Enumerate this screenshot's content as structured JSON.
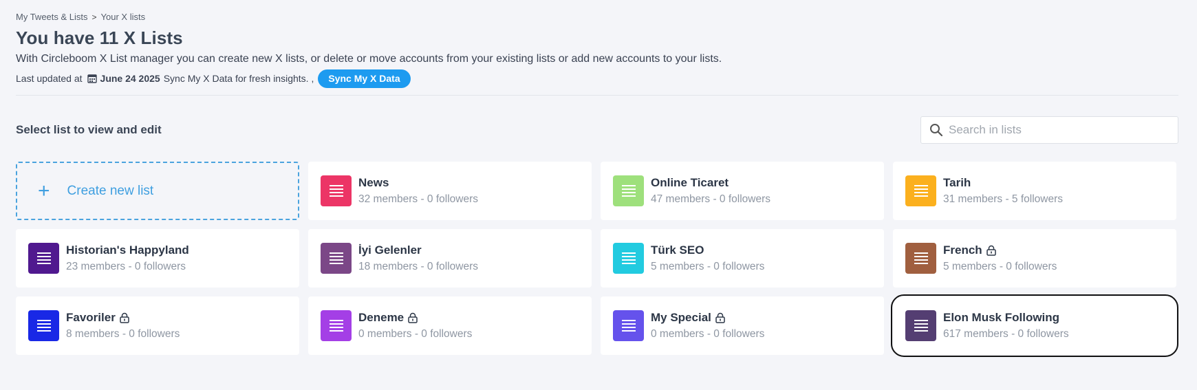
{
  "breadcrumb": {
    "item1": "My Tweets & Lists",
    "separator": ">",
    "item2": "Your X lists"
  },
  "header": {
    "title": "You have 11 X Lists",
    "description": "With Circleboom X List manager you can create new X lists, or delete or move accounts from your existing lists or add new accounts to your lists.",
    "last_updated_label": "Last updated at",
    "last_updated_date": "June 24 2025",
    "sync_text": "Sync My X Data for fresh insights. ,",
    "sync_button": "Sync My X Data"
  },
  "section": {
    "title": "Select list to view and edit"
  },
  "search": {
    "placeholder": "Search in lists",
    "value": ""
  },
  "create": {
    "plus": "+",
    "label": "Create new list"
  },
  "lists": [
    {
      "name": "News",
      "meta": "32 members - 0 followers",
      "color": "#ec3566",
      "locked": false
    },
    {
      "name": "Online Ticaret",
      "meta": "47 members - 0 followers",
      "color": "#9ee07c",
      "locked": false
    },
    {
      "name": "Tarih",
      "meta": "31 members - 5 followers",
      "color": "#fbb01e",
      "locked": false
    },
    {
      "name": "Historian's Happyland",
      "meta": "23 members - 0 followers",
      "color": "#50198f",
      "locked": false
    },
    {
      "name": "İyi Gelenler",
      "meta": "18 members - 0 followers",
      "color": "#7b4787",
      "locked": false
    },
    {
      "name": "Türk SEO",
      "meta": "5 members - 0 followers",
      "color": "#22cbe0",
      "locked": false
    },
    {
      "name": "French",
      "meta": "5 members - 0 followers",
      "color": "#a05f3f",
      "locked": true
    },
    {
      "name": "Favoriler",
      "meta": "8 members - 0 followers",
      "color": "#1928e6",
      "locked": true
    },
    {
      "name": "Deneme",
      "meta": "0 members - 0 followers",
      "color": "#a43fe6",
      "locked": true
    },
    {
      "name": "My Special",
      "meta": "0 members - 0 followers",
      "color": "#6552ec",
      "locked": true
    },
    {
      "name": "Elon Musk Following",
      "meta": "617 members - 0 followers",
      "color": "#543e72",
      "locked": false
    }
  ]
}
